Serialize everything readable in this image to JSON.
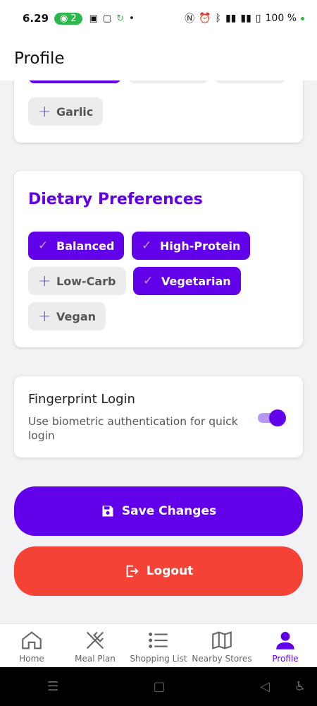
{
  "status": {
    "time": "6.29",
    "hotspot_count": "2",
    "battery": "100 %"
  },
  "app_bar": {
    "title": "Profile"
  },
  "ingredients_card": {
    "chips": [
      {
        "label": "Garlic",
        "selected": false
      }
    ]
  },
  "dietary": {
    "title": "Dietary Preferences",
    "chips": [
      {
        "label": "Balanced",
        "selected": true
      },
      {
        "label": "High-Protein",
        "selected": true
      },
      {
        "label": "Low-Carb",
        "selected": false
      },
      {
        "label": "Vegetarian",
        "selected": true
      },
      {
        "label": "Vegan",
        "selected": false
      }
    ]
  },
  "fingerprint": {
    "title": "Fingerprint Login",
    "description": "Use biometric authentication for quick login",
    "enabled": true
  },
  "actions": {
    "save_label": "Save Changes",
    "logout_label": "Logout"
  },
  "bottom_nav": {
    "items": [
      {
        "label": "Home",
        "icon": "home-icon"
      },
      {
        "label": "Meal Plan",
        "icon": "utensils-icon"
      },
      {
        "label": "Shopping List",
        "icon": "list-icon"
      },
      {
        "label": "Nearby Stores",
        "icon": "map-icon"
      },
      {
        "label": "Profile",
        "icon": "person-icon",
        "active": true
      }
    ]
  },
  "colors": {
    "primary": "#6200ea",
    "danger": "#f44336",
    "chip_off": "#ececec"
  }
}
